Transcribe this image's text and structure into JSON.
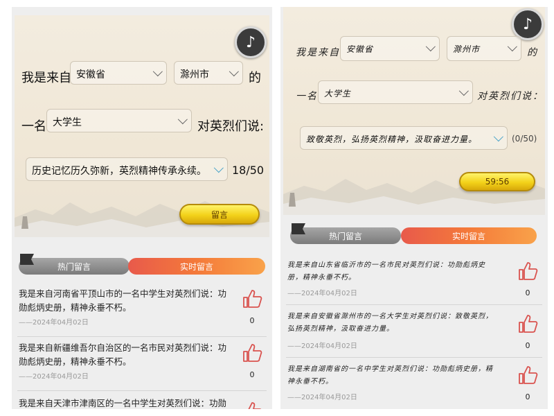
{
  "left": {
    "music_icon": "music-note-icon",
    "prefix": "我是来自",
    "province": "安徽省",
    "city": "滁州市",
    "suffix": "的",
    "role_prefix": "一名",
    "role": "大学生",
    "to_martyrs": "对英烈们说:",
    "message": "历史记忆历久弥新，英烈精神传承永续。",
    "counter": "18/50",
    "submit_label": "留言",
    "tab_hot": "热门留言",
    "tab_live": "实时留言",
    "comments": [
      {
        "text": "我是来自河南省平顶山市的一名中学生对英烈们说：功勋彪炳史册，精神永垂不朽。",
        "date": "——2024年04月02日",
        "likes": "0"
      },
      {
        "text": "我是来自新疆维吾尔自治区的一名市民对英烈们说：功勋彪炳史册，精神永垂不朽。",
        "date": "——2024年04月02日",
        "likes": "0"
      },
      {
        "text": "我是来自天津市津南区的一名中学生对英烈们说：功勋彪炳",
        "date": "",
        "likes": ""
      }
    ]
  },
  "right": {
    "music_icon": "music-note-icon",
    "prefix": "我是来自",
    "province": "安徽省",
    "city": "滁州市",
    "suffix": "的",
    "role_prefix": "一名",
    "role": "大学生",
    "to_martyrs": "对英烈们说：",
    "message": "致敬英烈，弘扬英烈精神，汲取奋进力量。",
    "counter": "(0/50)",
    "submit_label": "59:56",
    "tab_hot": "热门留言",
    "tab_live": "实时留言",
    "comments": [
      {
        "text": "我是来自山东省临沂市的一名市民对英烈们说：功勋彪炳史册，精神永垂不朽。",
        "date": "——2024年04月02日",
        "likes": "0"
      },
      {
        "text": "我是来自安徽省滁州市的一名大学生对英烈们说：致敬英烈，弘扬英烈精神，汲取奋进力量。",
        "date": "——2024年04月02日",
        "likes": "0"
      },
      {
        "text": "我是来自湖南省的一名中学生对英烈们说：功勋彪炳史册，精神永垂不朽。",
        "date": "——2024年04月02日",
        "likes": "0"
      }
    ]
  },
  "colors": {
    "gold": "#f3d21a",
    "live_tab": "#f47a3a",
    "hot_tab": "#8c8c8c",
    "like_red": "#d9534f"
  }
}
